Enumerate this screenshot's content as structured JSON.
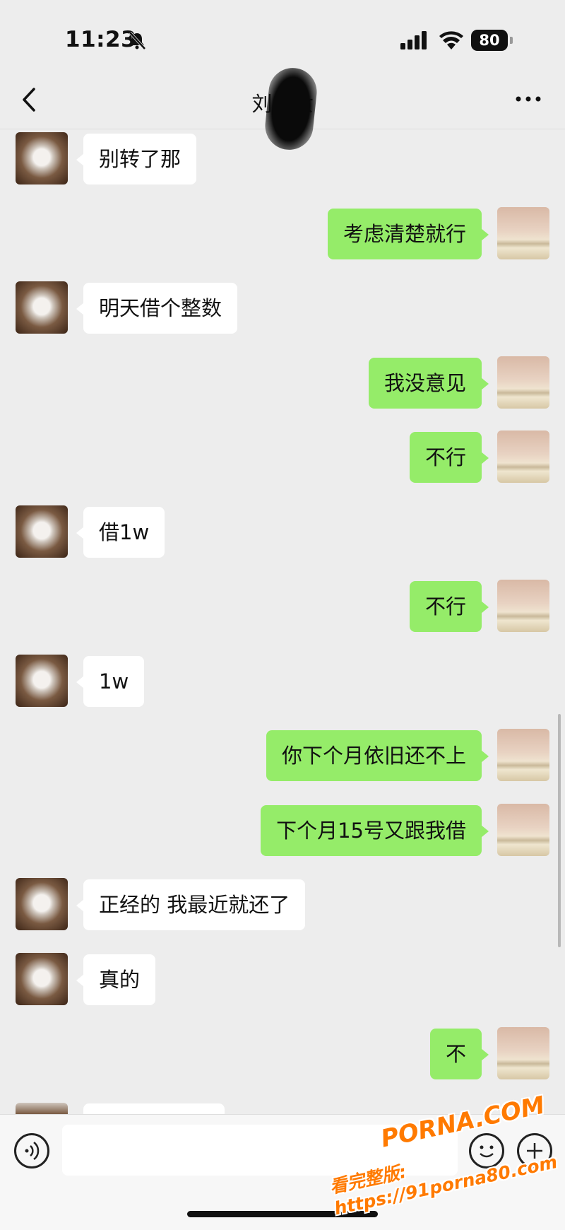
{
  "status_bar": {
    "time": "11:23",
    "battery": "80",
    "icons": [
      "bell-slash-icon",
      "cellular-signal-icon",
      "wifi-icon",
      "battery-icon"
    ]
  },
  "nav": {
    "title": "刘航汝",
    "back_icon": "chevron-left-icon",
    "more_icon": "ellipsis-icon"
  },
  "messages": [
    {
      "side": "left",
      "text": "别转了那"
    },
    {
      "side": "right",
      "text": "考虑清楚就行"
    },
    {
      "side": "left",
      "text": "明天借个整数"
    },
    {
      "side": "right",
      "text": "我没意见"
    },
    {
      "side": "right",
      "text": "不行"
    },
    {
      "side": "left",
      "text": "借1w"
    },
    {
      "side": "right",
      "text": "不行"
    },
    {
      "side": "left",
      "text": "1w"
    },
    {
      "side": "right",
      "text": "你下个月依旧还不上"
    },
    {
      "side": "right",
      "text": "下个月15号又跟我借"
    },
    {
      "side": "left",
      "text": "正经的 我最近就还了"
    },
    {
      "side": "left",
      "text": "真的"
    },
    {
      "side": "right",
      "text": "不"
    }
  ],
  "input_bar": {
    "voice_icon": "voice-icon",
    "emoji_icon": "emoji-icon",
    "add_icon": "plus-circle-icon"
  },
  "watermark": {
    "line1": "PORNA.COM",
    "line2": "看完整版: https://91porna80.com"
  },
  "colors": {
    "background": "#ededed",
    "bubble_self": "#95ec69",
    "bubble_other": "#ffffff",
    "watermark": "#ff7a00"
  }
}
